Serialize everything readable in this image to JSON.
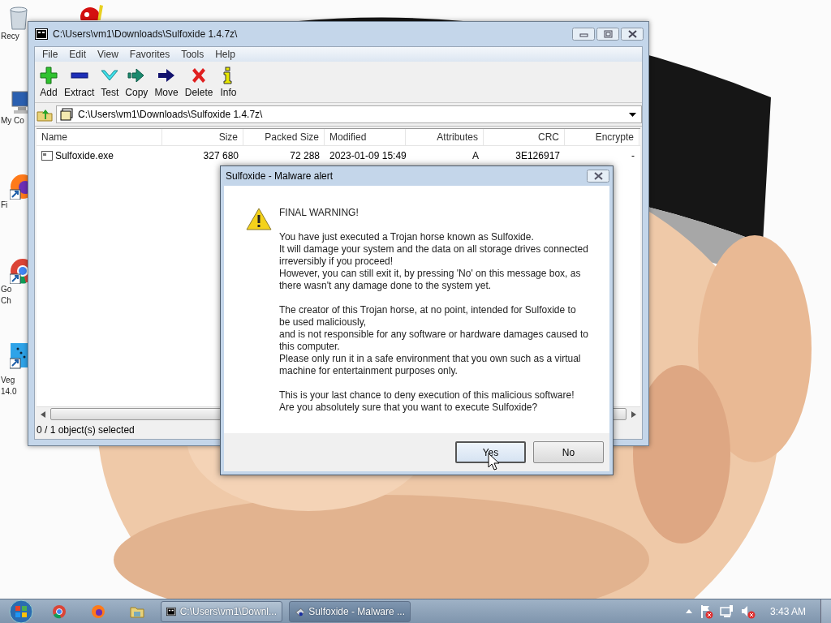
{
  "desktop": {
    "icons": [
      {
        "kind": "recycle",
        "lines": [
          "Recy"
        ]
      },
      {
        "kind": "computer",
        "lines": [
          "My Co"
        ]
      },
      {
        "kind": "firefox",
        "lines": [
          "Fi"
        ]
      },
      {
        "kind": "chrome",
        "lines": [
          "Go",
          "Ch"
        ]
      },
      {
        "kind": "vegas",
        "lines": [
          "Veg",
          "14.0"
        ]
      }
    ]
  },
  "archive_window": {
    "title": "C:\\Users\\vm1\\Downloads\\Sulfoxide 1.4.7z\\",
    "menu": [
      "File",
      "Edit",
      "View",
      "Favorites",
      "Tools",
      "Help"
    ],
    "toolbar": [
      {
        "kind": "add",
        "label": "Add"
      },
      {
        "kind": "extract",
        "label": "Extract"
      },
      {
        "kind": "test",
        "label": "Test"
      },
      {
        "kind": "copy",
        "label": "Copy"
      },
      {
        "kind": "move",
        "label": "Move"
      },
      {
        "kind": "delete",
        "label": "Delete"
      },
      {
        "kind": "info",
        "label": "Info"
      }
    ],
    "address": "C:\\Users\\vm1\\Downloads\\Sulfoxide 1.4.7z\\",
    "table": {
      "columns": [
        "Name",
        "Size",
        "Packed Size",
        "Modified",
        "Attributes",
        "CRC",
        "Encrypte"
      ],
      "rows": [
        {
          "cells": [
            "Sulfoxide.exe",
            "327 680",
            "72 288",
            "2023-01-09 15:49",
            "A",
            "3E126917",
            "-"
          ]
        }
      ]
    },
    "status_bar": "0 / 1 object(s) selected"
  },
  "dialog": {
    "title": "Sulfoxide - Malware alert",
    "paragraphs": [
      [
        "FINAL WARNING!"
      ],
      [
        "You have just executed a Trojan horse known as Sulfoxide.",
        "It will damage your system and the data on all storage drives connected",
        "irreversibly if you proceed!",
        "However, you can still exit it, by pressing 'No' on this message box, as",
        "there wasn't any damage done to the system yet."
      ],
      [
        "The creator of this Trojan horse, at no point, intended for Sulfoxide to",
        "be used maliciously,",
        "and is not responsible for any software or hardware damages caused to",
        "this computer.",
        "Please only run it in a safe environment that you own such as a virtual",
        "machine for entertainment purposes only."
      ],
      [
        "This is your last chance to deny execution of this malicious software!",
        "Are you absolutely sure that you want to execute Sulfoxide?"
      ]
    ],
    "buttons": [
      {
        "label": "Yes",
        "focused": true
      },
      {
        "label": "No",
        "focused": false
      }
    ]
  },
  "taskbar": {
    "pinned": [
      {
        "kind": "chrome"
      },
      {
        "kind": "firefox"
      },
      {
        "kind": "explorer"
      }
    ],
    "tasks": [
      {
        "kind": "archive",
        "label": "C:\\Users\\vm1\\Downl...",
        "active": false
      },
      {
        "kind": "alert",
        "label": "Sulfoxide - Malware ...",
        "active": true
      }
    ],
    "clock": "3:43 AM"
  }
}
